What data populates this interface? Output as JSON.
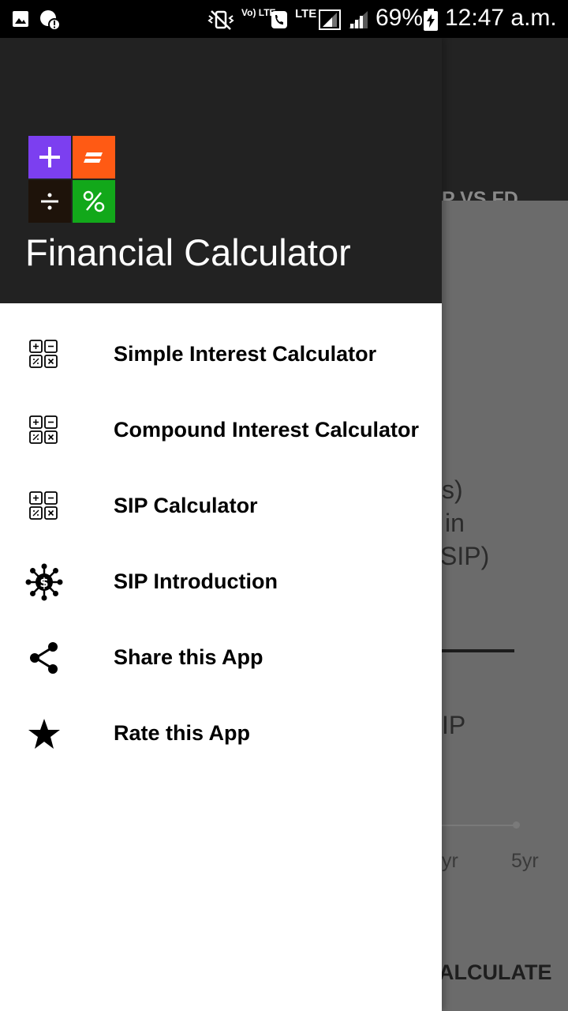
{
  "status_bar": {
    "battery": "69%",
    "time": "12:47 a.m.",
    "network_label": "LTE",
    "volte_label": "Vo) LTE"
  },
  "background_app": {
    "tab_label": "P VS FD",
    "text_lines": [
      "s)",
      "in",
      "SIP)",
      "IP"
    ],
    "axis_labels": [
      "yr",
      "5yr"
    ],
    "calculate_label": "ALCULATE"
  },
  "drawer": {
    "title": "Financial Calculator",
    "logo": {
      "cells": [
        {
          "glyph": "+",
          "color": "#7c3ff0"
        },
        {
          "glyph": "=",
          "color": "#ff5a14"
        },
        {
          "glyph": "÷",
          "color": "#1e130a"
        },
        {
          "glyph": "%",
          "color": "#12a81a"
        }
      ]
    },
    "items": [
      {
        "label": "Simple Interest Calculator",
        "icon": "calculator-icon"
      },
      {
        "label": "Compound Interest Calculator",
        "icon": "calculator-icon"
      },
      {
        "label": "SIP Calculator",
        "icon": "calculator-icon"
      },
      {
        "label": "SIP Introduction",
        "icon": "money-network-icon"
      },
      {
        "label": "Share this App",
        "icon": "share-icon"
      },
      {
        "label": "Rate this App",
        "icon": "star-icon"
      }
    ]
  }
}
